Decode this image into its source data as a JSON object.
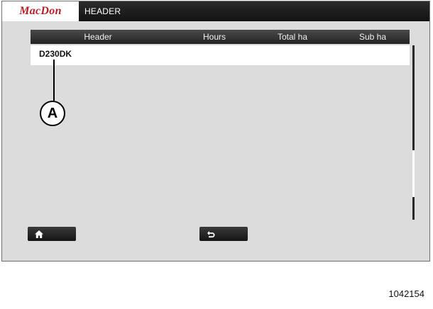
{
  "header_bar": {
    "brand": "MacDon",
    "title": "HEADER"
  },
  "table": {
    "columns": [
      "Header",
      "Hours",
      "Total ha",
      "Sub ha"
    ],
    "rows": [
      {
        "name": "D230DK",
        "hours": "",
        "total_ha": "",
        "sub_ha": ""
      }
    ]
  },
  "footer": {
    "home_icon": "home-icon",
    "back_icon": "back-arrow-icon"
  },
  "callout": {
    "label": "A"
  },
  "figure_number": "1042154",
  "colors": {
    "brand_red": "#b3202a",
    "bar_dark": "#1a1a1a",
    "screen_bg": "#dcdcdc"
  }
}
